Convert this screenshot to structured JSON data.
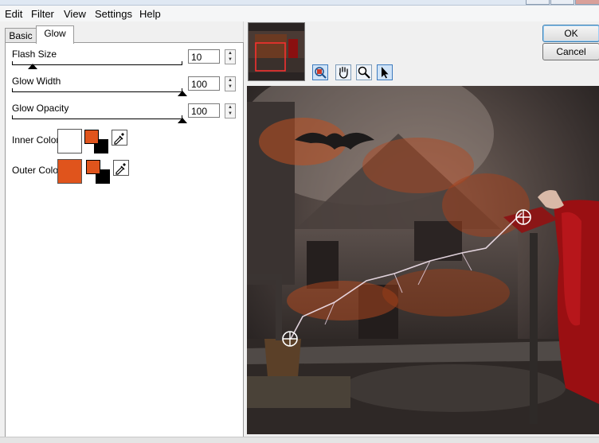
{
  "menu": {
    "items": [
      "Edit",
      "Filter",
      "View",
      "Settings",
      "Help"
    ]
  },
  "tabs": [
    {
      "label": "Basic"
    },
    {
      "label": "Glow"
    }
  ],
  "active_tab": "Glow",
  "controls": {
    "flash_size": {
      "label": "Flash Size",
      "value": "10",
      "fraction": 0.1
    },
    "glow_width": {
      "label": "Glow Width",
      "value": "100",
      "fraction": 1.0
    },
    "glow_opacity": {
      "label": "Glow Opacity",
      "value": "100",
      "fraction": 1.0
    }
  },
  "colors": {
    "inner": {
      "label": "Inner Color",
      "swatch": "#ffffff",
      "fg": "#e0541c",
      "bg": "#000000"
    },
    "outer": {
      "label": "Outer Color",
      "swatch": "#e0541c",
      "fg": "#e0541c",
      "bg": "#000000"
    }
  },
  "buttons": {
    "ok": "OK",
    "cancel": "Cancel"
  },
  "tools": [
    "navigator-tool",
    "hand-tool",
    "zoom-tool",
    "pointer-tool"
  ],
  "accent": "#e0541c"
}
